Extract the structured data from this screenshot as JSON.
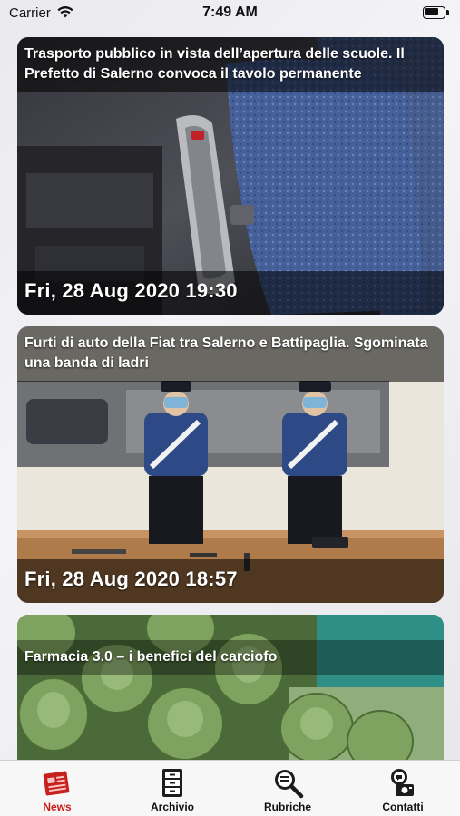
{
  "status_bar": {
    "carrier": "Carrier",
    "time": "7:49 AM"
  },
  "feed": {
    "articles": [
      {
        "title": "Trasporto pubblico in vista dell’apertura delle scuole. Il Prefetto di Salerno convoca il tavolo permanente",
        "date": "Fri, 28 Aug 2020 19:30",
        "image_icon": "bus-seat-photo"
      },
      {
        "title": "Furti di auto della Fiat tra Salerno e Battipaglia. Sgominata una banda di ladri",
        "date": "Fri, 28 Aug 2020 18:57",
        "image_icon": "carabinieri-photo"
      },
      {
        "title": "Farmacia 3.0 – i benefici del carciofo",
        "date": "",
        "image_icon": "artichokes-photo"
      }
    ]
  },
  "tab_bar": {
    "tabs": [
      {
        "label": "News",
        "icon": "newspaper-icon",
        "active": true
      },
      {
        "label": "Archivio",
        "icon": "archive-cabinet-icon",
        "active": false
      },
      {
        "label": "Rubriche",
        "icon": "magnifier-icon",
        "active": false
      },
      {
        "label": "Contatti",
        "icon": "contacts-icon",
        "active": false
      }
    ]
  },
  "colors": {
    "active_tab": "#c8201c",
    "overlay": "rgba(0,0,0,0.55)"
  }
}
